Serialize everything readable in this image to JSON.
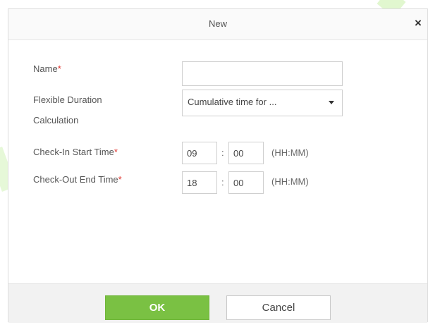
{
  "dialog": {
    "title": "New",
    "close_glyph": "×"
  },
  "form": {
    "name": {
      "label": "Name",
      "required_mark": "*",
      "value": ""
    },
    "flexible": {
      "label_line1": "Flexible Duration",
      "label_line2": "Calculation",
      "selected": "Cumulative time for ..."
    },
    "check_in": {
      "label": "Check-In Start Time",
      "required_mark": "*",
      "hour": "09",
      "minute": "00",
      "separator": ":",
      "format_hint": "(HH:MM)"
    },
    "check_out": {
      "label": "Check-Out End Time",
      "required_mark": "*",
      "hour": "18",
      "minute": "00",
      "separator": ":",
      "format_hint": "(HH:MM)"
    }
  },
  "footer": {
    "ok_label": "OK",
    "cancel_label": "Cancel"
  },
  "colors": {
    "accent": "#7ac143",
    "required": "#e0352f"
  }
}
